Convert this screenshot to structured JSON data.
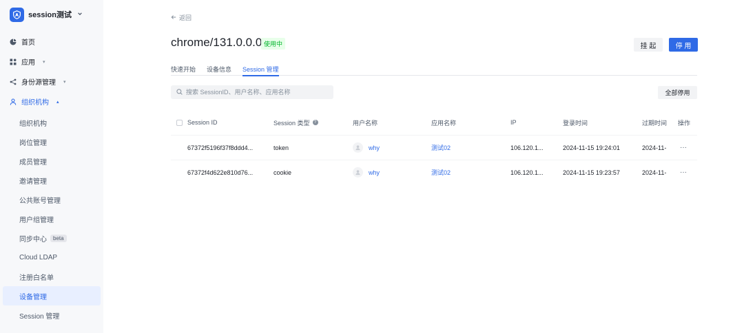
{
  "brand": {
    "name": "session测试"
  },
  "nav": {
    "top_items": [
      {
        "label": "首页",
        "icon": "pie-chart-icon",
        "has_chevron": false
      },
      {
        "label": "应用",
        "icon": "apps-icon",
        "has_chevron": true
      },
      {
        "label": "身份源管理",
        "icon": "share-icon",
        "has_chevron": true
      },
      {
        "label": "组织机构",
        "icon": "user-group-icon",
        "has_chevron": true
      }
    ],
    "sub_items": [
      {
        "label": "组织机构"
      },
      {
        "label": "岗位管理"
      },
      {
        "label": "成员管理"
      },
      {
        "label": "邀请管理"
      },
      {
        "label": "公共账号管理"
      },
      {
        "label": "用户组管理"
      },
      {
        "label": "同步中心",
        "badge": "beta"
      },
      {
        "label": "Cloud LDAP"
      },
      {
        "label": "注册白名单"
      },
      {
        "label": "设备管理"
      },
      {
        "label": "Session 管理"
      }
    ]
  },
  "header": {
    "back_label": "返回",
    "title": "chrome/131.0.0.0",
    "status": "使用中",
    "suspend_label": "挂 起",
    "disable_label": "停 用"
  },
  "tabs": [
    {
      "label": "快速开始"
    },
    {
      "label": "设备信息"
    },
    {
      "label": "Session 管理"
    }
  ],
  "search": {
    "placeholder": "搜索 SessionID、用户名称、应用名称"
  },
  "toolbar": {
    "disable_all_label": "全部停用"
  },
  "table": {
    "columns": [
      {
        "label": "Session ID"
      },
      {
        "label": "Session 类型"
      },
      {
        "label": "用户名称"
      },
      {
        "label": "应用名称"
      },
      {
        "label": "IP"
      },
      {
        "label": "登录时间"
      },
      {
        "label": "过期时间"
      },
      {
        "label": "操作"
      }
    ],
    "rows": [
      {
        "session_id": "67372f5196f37f8ddd4...",
        "type": "token",
        "user": "why",
        "app": "测试02",
        "ip": "106.120.1...",
        "login_time": "2024-11-15 19:24:01",
        "expire_time": "2024-11-",
        "action": "···"
      },
      {
        "session_id": "67372f4d622e810d76...",
        "type": "cookie",
        "user": "why",
        "app": "测试02",
        "ip": "106.120.1...",
        "login_time": "2024-11-15 19:23:57",
        "expire_time": "2024-11-",
        "action": "···"
      }
    ]
  },
  "colors": {
    "accent": "#2f6ae6",
    "success": "#00b42a",
    "success_bg": "#e8ffea",
    "sidebar_bg": "#f7f8fa"
  }
}
